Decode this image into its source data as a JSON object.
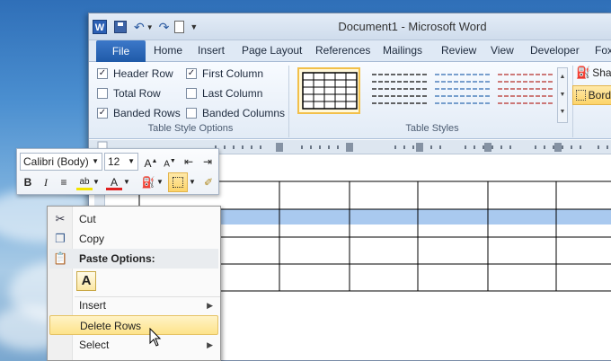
{
  "window": {
    "title": "Document1  -  Microsoft Word",
    "app_icon": "W"
  },
  "tabs": [
    "File",
    "Home",
    "Insert",
    "Page Layout",
    "References",
    "Mailings",
    "Review",
    "View",
    "Developer",
    "Fox"
  ],
  "table_style_options": {
    "items": [
      {
        "label": "Header Row",
        "checked": true
      },
      {
        "label": "Total Row",
        "checked": false
      },
      {
        "label": "Banded Rows",
        "checked": true
      },
      {
        "label": "First Column",
        "checked": true
      },
      {
        "label": "Last Column",
        "checked": false
      },
      {
        "label": "Banded Columns",
        "checked": false
      }
    ],
    "group_label": "Table Style Options"
  },
  "table_styles": {
    "group_label": "Table Styles",
    "shading_label": "Shac",
    "borders_label": "Bord"
  },
  "mini_toolbar": {
    "font": "Calibri (Body)",
    "size": "12",
    "bold": "B",
    "italic": "I",
    "font_color": "A"
  },
  "context_menu": {
    "cut": "Cut",
    "copy": "Copy",
    "paste_options": "Paste Options:",
    "paste_keep": "A",
    "insert": "Insert",
    "delete_rows": "Delete Rows",
    "select": "Select"
  },
  "colors": {
    "accent": "#1f5aa8",
    "highlight": "#fde38a",
    "selected_row": "#a9c9ef"
  }
}
